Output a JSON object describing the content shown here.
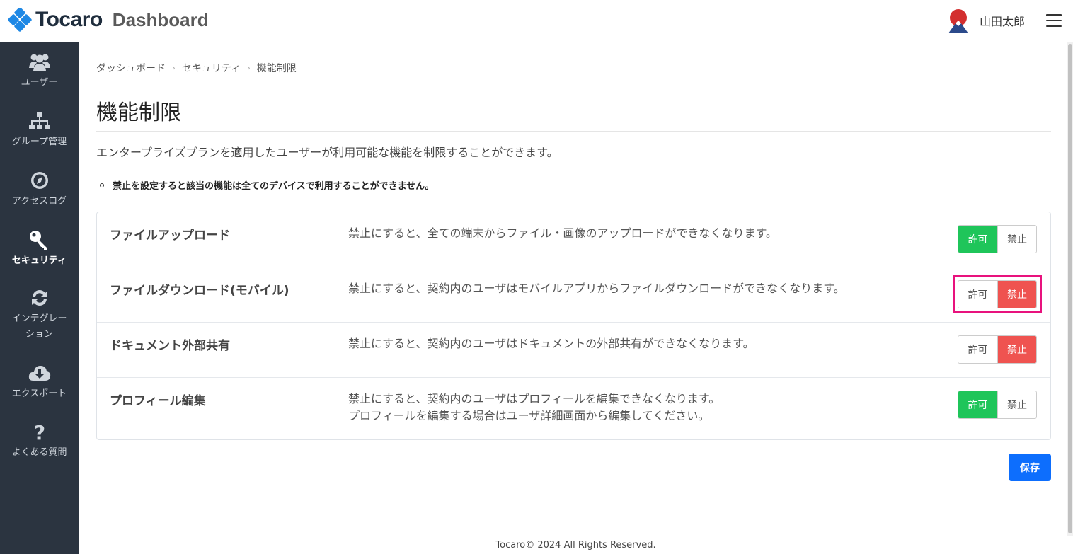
{
  "header": {
    "logo_text": "Tocaro",
    "app_name": "Dashboard",
    "user_name": "山田太郎",
    "logo_color": "#1e88e5"
  },
  "sidebar": {
    "items": [
      {
        "label": "ユーザー",
        "icon": "users-icon",
        "active": false
      },
      {
        "label": "グループ管理",
        "icon": "sitemap-icon",
        "active": false
      },
      {
        "label": "アクセスログ",
        "icon": "compass-icon",
        "active": false
      },
      {
        "label": "セキュリティ",
        "icon": "key-icon",
        "active": true
      },
      {
        "label": "インテグレーション",
        "icon": "sync-icon",
        "active": false
      },
      {
        "label": "エクスポート",
        "icon": "cloud-download-icon",
        "active": false
      },
      {
        "label": "よくある質問",
        "icon": "question-icon",
        "active": false
      }
    ]
  },
  "breadcrumb": [
    "ダッシュボード",
    "セキュリティ",
    "機能制限"
  ],
  "page": {
    "title": "機能制限",
    "description": "エンタープライズプランを適用したユーザーが利用可能な機能を制限することができます。",
    "notice": "禁止を設定すると該当の機能は全てのデバイスで利用することができません。"
  },
  "settings": [
    {
      "name": "ファイルアップロード",
      "desc1": "禁止にすると、全ての端末からファイル・画像のアップロードができなくなります。",
      "desc2": "",
      "state": "allow"
    },
    {
      "name": "ファイルダウンロード(モバイル)",
      "desc1": "禁止にすると、契約内のユーザはモバイルアプリからファイルダウンロードができなくなります。",
      "desc2": "",
      "state": "deny"
    },
    {
      "name": "ドキュメント外部共有",
      "desc1": "禁止にすると、契約内のユーザはドキュメントの外部共有ができなくなります。",
      "desc2": "",
      "state": "deny"
    },
    {
      "name": "プロフィール編集",
      "desc1": "禁止にすると、契約内のユーザはプロフィールを編集できなくなります。",
      "desc2": "プロフィールを編集する場合はユーザ詳細画面から編集してください。",
      "state": "allow"
    }
  ],
  "toggle_labels": {
    "allow": "許可",
    "deny": "禁止"
  },
  "colors": {
    "allow": "#1fc55a",
    "deny": "#ef5350",
    "highlight": "#e8127d",
    "primary": "#0d6efd",
    "sidebar_bg": "#2b3440"
  },
  "save_label": "保存",
  "footer": "Tocaro© 2024 All Rights Reserved."
}
